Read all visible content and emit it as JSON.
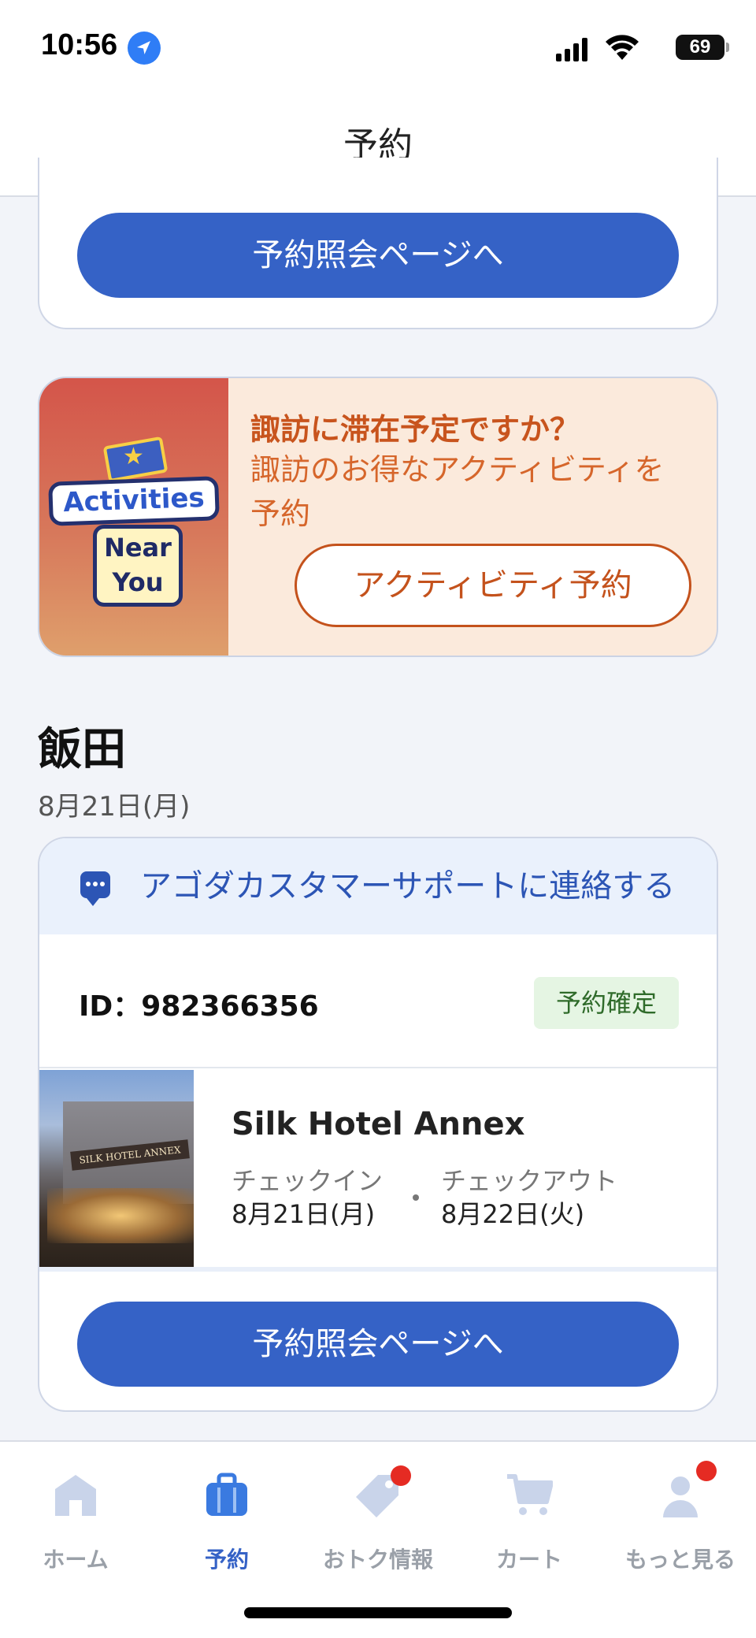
{
  "status_bar": {
    "time": "10:56",
    "battery": "69"
  },
  "header": {
    "title": "予約"
  },
  "top_card": {
    "button_label": "予約照会ページへ"
  },
  "activities_banner": {
    "image_words": [
      "Activities",
      "Near",
      "You"
    ],
    "title": "諏訪に滞在予定ですか？",
    "subtitle_line1": "諏訪のお得なアクティビティを",
    "subtitle_line2": "予約",
    "button_label": "アクティビティ予約"
  },
  "city_section": {
    "city": "飯田",
    "date": "8月21日(月)"
  },
  "booking": {
    "support_label": "アゴダカスタマーサポートに連絡する",
    "id_label": "ID：982366356",
    "status": "予約確定",
    "hotel_name": "Silk Hotel Annex",
    "hotel_sign": "SILK HOTEL ANNEX",
    "check_in_label": "チェックイン",
    "check_in_date": "8月21日(月)",
    "check_out_label": "チェックアウト",
    "check_out_date": "8月22日(火)",
    "button_label": "予約照会ページへ"
  },
  "tab_bar": {
    "tabs": [
      {
        "label": "ホーム",
        "icon": "home-icon",
        "active": false,
        "badge": false
      },
      {
        "label": "予約",
        "icon": "briefcase-icon",
        "active": true,
        "badge": false
      },
      {
        "label": "おトク情報",
        "icon": "tag-icon",
        "active": false,
        "badge": true
      },
      {
        "label": "カート",
        "icon": "cart-icon",
        "active": false,
        "badge": false
      },
      {
        "label": "もっと見る",
        "icon": "user-icon",
        "active": false,
        "badge": true
      }
    ]
  },
  "colors": {
    "primary": "#3562c6",
    "banner_orange": "#c8541d",
    "badge_red": "#e52b23",
    "status_green_bg": "#e5f5e3"
  }
}
